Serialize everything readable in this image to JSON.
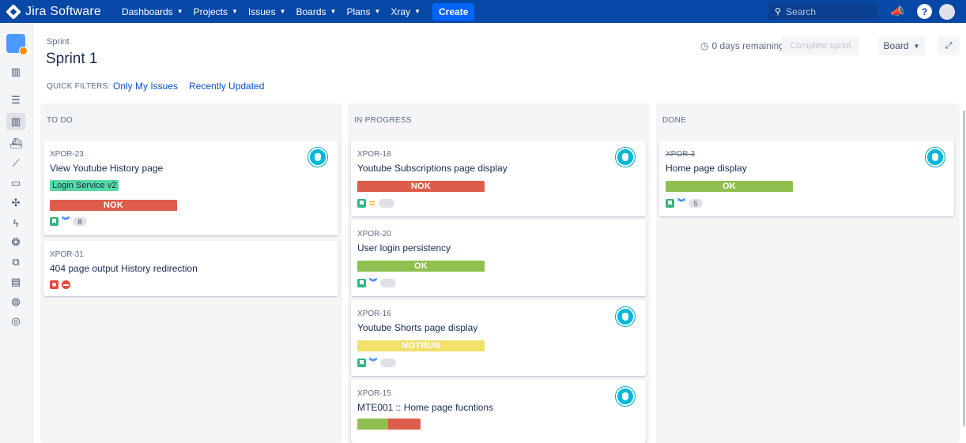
{
  "topnav": {
    "brand": "Jira Software",
    "items": [
      "Dashboards",
      "Projects",
      "Issues",
      "Boards",
      "Plans",
      "Xray"
    ],
    "create_label": "Create",
    "search_placeholder": "Search"
  },
  "header": {
    "breadcrumb": "Sprint",
    "title": "Sprint 1",
    "quick_filters_label": "QUICK FILTERS:",
    "quick_filters": [
      "Only My Issues",
      "Recently Updated"
    ],
    "days_remaining": "0 days remaining",
    "complete_sprint_label": "Complete sprint",
    "board_label": "Board"
  },
  "columns": [
    {
      "title": "TO DO",
      "cards": [
        {
          "key": "XPOR-23",
          "summary": "View Youtube History page",
          "epic": "Login Service v2",
          "status": "NOK",
          "type": "story",
          "priority": "low",
          "badge": "8",
          "avatar": true
        },
        {
          "key": "XPOR-31",
          "summary": "404 page output History redirection",
          "type": "bug",
          "priority": "blocker"
        }
      ]
    },
    {
      "title": "IN PROGRESS",
      "cards": [
        {
          "key": "XPOR-18",
          "summary": "Youtube Subscriptions page display",
          "status": "NOK",
          "type": "story",
          "priority": "medium",
          "badge": "",
          "avatar": true
        },
        {
          "key": "XPOR-20",
          "summary": "User login persistency",
          "status": "OK",
          "type": "story",
          "priority": "low",
          "badge": ""
        },
        {
          "key": "XPOR-16",
          "summary": "Youtube Shorts page display",
          "status": "NOTRUN",
          "type": "story",
          "priority": "low",
          "badge": "",
          "avatar": true
        },
        {
          "key": "XPOR-15",
          "summary": "MTE001 :: Home page fucntions",
          "status": "",
          "avatar": true
        }
      ]
    },
    {
      "title": "DONE",
      "cards": [
        {
          "key": "XPOR-3",
          "summary": "Home page display",
          "status": "OK",
          "type": "story",
          "priority": "low",
          "badge": "5",
          "avatar": true
        }
      ]
    }
  ],
  "colors": {
    "nav": "#0747a6",
    "nok": "#de5c4a",
    "ok": "#8fbf4e",
    "notrun": "#f2e06a",
    "epic": "#57d9a3"
  }
}
